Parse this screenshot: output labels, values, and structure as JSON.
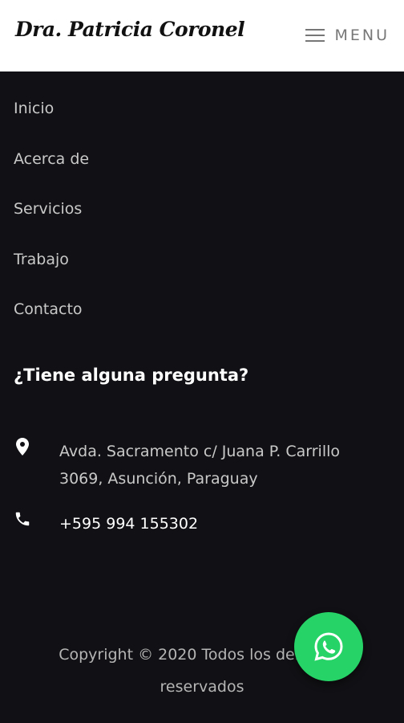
{
  "header": {
    "brand": "Dra. Patricia Coronel",
    "menu_label": "MENU"
  },
  "nav": {
    "items": [
      {
        "label": "Inicio"
      },
      {
        "label": "Acerca de"
      },
      {
        "label": "Servicios"
      },
      {
        "label": "Trabajo"
      },
      {
        "label": "Contacto"
      }
    ]
  },
  "contact": {
    "heading": "¿Tiene alguna pregunta?",
    "address": "Avda. Sacramento c/ Juana P. Carrillo 3069, Asunción, Paraguay",
    "phone": "+595 994 155302",
    "icons": {
      "address": "map-pin-icon",
      "phone": "phone-icon"
    }
  },
  "footer": {
    "copyright_line1": "Copyright © 2020 Todos los derechos",
    "copyright_line2": "reservados"
  },
  "whatsapp": {
    "icon": "whatsapp-icon",
    "color": "#25d366"
  },
  "colors": {
    "background": "#111014",
    "header": "#ffffff",
    "text": "#c9c9c9"
  }
}
